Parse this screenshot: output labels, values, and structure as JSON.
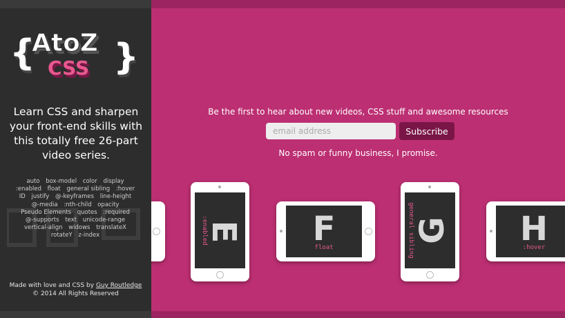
{
  "logo": {
    "title": "AtoZ",
    "subtitle": "CSS"
  },
  "sidebar": {
    "tagline": "Learn CSS and sharpen your front-end skills with this totally free 26-part video series.",
    "tags": [
      "auto",
      "box-model",
      "color",
      "display",
      ":enabled",
      "float",
      "general sibling",
      ":hover",
      "ID",
      "justify",
      "@-keyframes",
      "line-height",
      "@-media",
      ":nth-child",
      "opacity",
      "Pseudo Elements",
      "quotes",
      ":required",
      "@-supports",
      "text",
      "unicode-range",
      "vertical-align",
      "widows",
      "translateX",
      "rotateY",
      "z-index"
    ],
    "footer_prefix": "Made with love and CSS by ",
    "footer_author": "Guy Routledge",
    "footer_copyright": "© 2014 All Rights Reserved"
  },
  "signup": {
    "headline": "Be the first to hear about new videos, CSS stuff and awesome resources",
    "email_placeholder": "email address",
    "subscribe_label": "Subscribe",
    "no_spam": "No spam or funny business, I promise."
  },
  "tablets": [
    {
      "letter": "E",
      "property": ":enabled"
    },
    {
      "letter": "F",
      "property": "float"
    },
    {
      "letter": "G",
      "property": "general sibling"
    },
    {
      "letter": "H",
      "property": ":hover"
    }
  ],
  "colors": {
    "sidebar_bg": "#2d2d2d",
    "main_bg": "#bc2f72",
    "accent": "#e8588f",
    "subscribe_bg": "#7a1647"
  }
}
